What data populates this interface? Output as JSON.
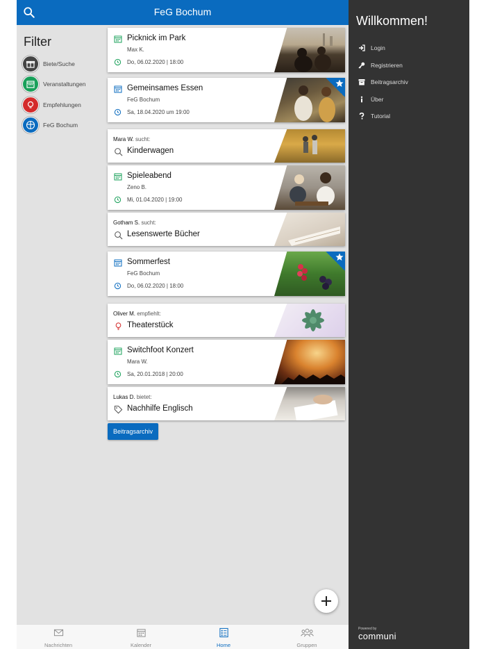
{
  "header": {
    "title": "FeG Bochum"
  },
  "filter": {
    "title": "Filter",
    "items": [
      {
        "label": "Biete/Suche",
        "color": "#444444"
      },
      {
        "label": "Veranstaltungen",
        "color": "#19a05a"
      },
      {
        "label": "Empfehlungen",
        "color": "#d42b2b"
      },
      {
        "label": "FeG Bochum",
        "color": "#0a6bbf"
      }
    ]
  },
  "feed": {
    "events": [
      {
        "title": "Picknick im Park",
        "sub": "Max K.",
        "date": "Do, 06.02.2020 | 18:00"
      },
      {
        "title": "Gemeinsames Essen",
        "sub": "FeG Bochum",
        "date": "Sa, 18.04.2020 um 19:00"
      },
      {
        "title": "Spieleabend",
        "sub": "Zeno B.",
        "date": "Mi, 01.04.2020 | 19:00"
      },
      {
        "title": "Sommerfest",
        "sub": "FeG Bochum",
        "date": "Do, 06.02.2020 | 18:00"
      },
      {
        "title": "Switchfoot Konzert",
        "sub": "Mara W.",
        "date": "Sa, 20.01.2018 | 20:00"
      }
    ],
    "posts": [
      {
        "author": "Mara W.",
        "verb": "sucht:",
        "title": "Kinderwagen"
      },
      {
        "author": "Gotham S.",
        "verb": "sucht:",
        "title": "Lesenswerte Bücher"
      },
      {
        "author": "Oliver M.",
        "verb": "empfiehlt:",
        "title": "Theaterstück"
      },
      {
        "author": "Lukas D.",
        "verb": "bietet:",
        "title": "Nachhilfe Englisch"
      }
    ],
    "archive_button": "Beitragsarchiv"
  },
  "bottom_nav": {
    "items": [
      {
        "label": "Nachrichten"
      },
      {
        "label": "Kalender"
      },
      {
        "label": "Home"
      },
      {
        "label": "Gruppen"
      }
    ]
  },
  "drawer": {
    "title": "Willkommen!",
    "items": [
      {
        "label": "Login",
        "icon": "sign-in-icon"
      },
      {
        "label": "Registrieren",
        "icon": "key-icon"
      },
      {
        "label": "Beitragsarchiv",
        "icon": "archive-icon"
      },
      {
        "label": "Über",
        "icon": "info-icon"
      },
      {
        "label": "Tutorial",
        "icon": "question-icon"
      }
    ],
    "powered_by": "Powered by",
    "brand": "communi"
  },
  "colors": {
    "accent": "#0a6bbf",
    "drawer_bg": "#333333",
    "event_green": "#19a05a"
  }
}
